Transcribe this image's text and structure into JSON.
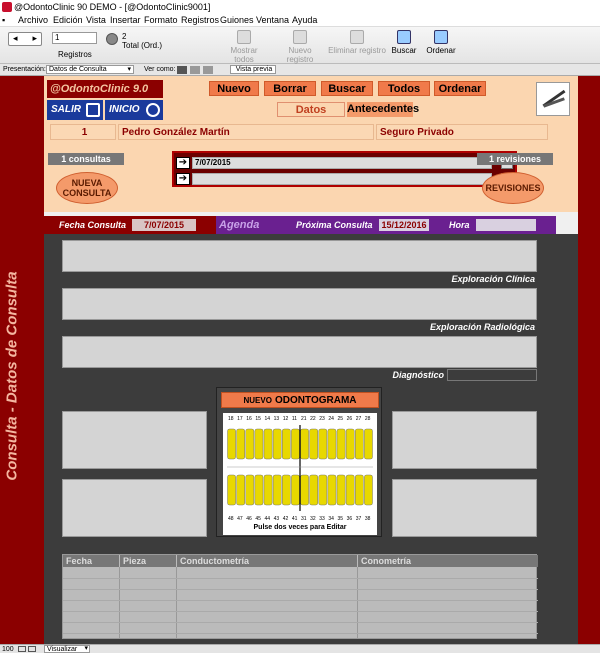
{
  "window": {
    "title": "@OdontoClinic 90 DEMO - [@OdontoClinic9001]"
  },
  "menu": [
    "Archivo",
    "Edición",
    "Vista",
    "Insertar",
    "Formato",
    "Registros",
    "Guiones",
    "Ventana",
    "Ayuda"
  ],
  "toolbar": {
    "record_value": "1",
    "records_label": "Registros",
    "total_value": "2",
    "total_label": "Total (Ord.)",
    "btn_show_all": "Mostrar todos",
    "btn_new_record": "Nuevo registro",
    "btn_delete_record": "Eliminar registro",
    "btn_search": "Buscar",
    "btn_sort": "Ordenar"
  },
  "layoutbar": {
    "label": "Presentación:",
    "layout_value": "Datos de Consulta",
    "view_label": "Ver como:",
    "preview_button": "Vista previa"
  },
  "sidebar": {
    "vertical_title": "Consulta - Datos de Consulta"
  },
  "header": {
    "logo": "@OdontoClinic 9.0",
    "exit_label": "SALIR",
    "home_label": "INICIO",
    "btn_new": "Nuevo",
    "btn_delete": "Borrar",
    "btn_search": "Buscar",
    "btn_all": "Todos",
    "btn_sort": "Ordenar",
    "tab_data": "Datos",
    "tab_history": "Antecedentes"
  },
  "patient": {
    "id": "1",
    "name": "Pedro González Martín",
    "insurance": "Seguro Privado"
  },
  "consultations": {
    "count_label": "1 consultas",
    "new_button": "NUEVA\nCONSULTA",
    "portal_rows": [
      {
        "date": "7/07/2015"
      },
      {
        "date": ""
      }
    ],
    "revisions_count": "1 revisiones",
    "revisions_button": "REVISIONES"
  },
  "datestrip": {
    "fecha_label": "Fecha Consulta",
    "fecha_value": "7/07/2015",
    "agenda_label": "Agenda",
    "proxima_label": "Próxima Consulta",
    "proxima_value": "15/12/2016",
    "hora_label": "Hora",
    "hora_value": ""
  },
  "fields": {
    "exploracion_clinica": "Exploración Clínica",
    "exploracion_radiologica": "Exploración Radiológica",
    "diagnostico": "Diagnóstico"
  },
  "odontograma": {
    "button_prefix": "NUEVO",
    "button_main": "ODONTOGRAMA",
    "upper_numbers": [
      "18",
      "17",
      "16",
      "15",
      "14",
      "13",
      "12",
      "11",
      "21",
      "22",
      "23",
      "24",
      "25",
      "26",
      "27",
      "28"
    ],
    "lower_numbers": [
      "48",
      "47",
      "46",
      "45",
      "44",
      "43",
      "42",
      "41",
      "31",
      "32",
      "33",
      "34",
      "35",
      "36",
      "37",
      "38"
    ],
    "caption": "Pulse dos veces para Editar"
  },
  "grid": {
    "columns": [
      "Fecha",
      "Pieza",
      "Conductometría",
      "Conometría"
    ]
  },
  "status": {
    "zoom": "100",
    "mode": "Visualizar"
  },
  "colors": {
    "maroon": "#8b0000",
    "peach": "#fbd6b0",
    "orange": "#f07a4a",
    "purple": "#6a2090",
    "blue": "#1a3a9c",
    "tooth": "#e8d800"
  }
}
